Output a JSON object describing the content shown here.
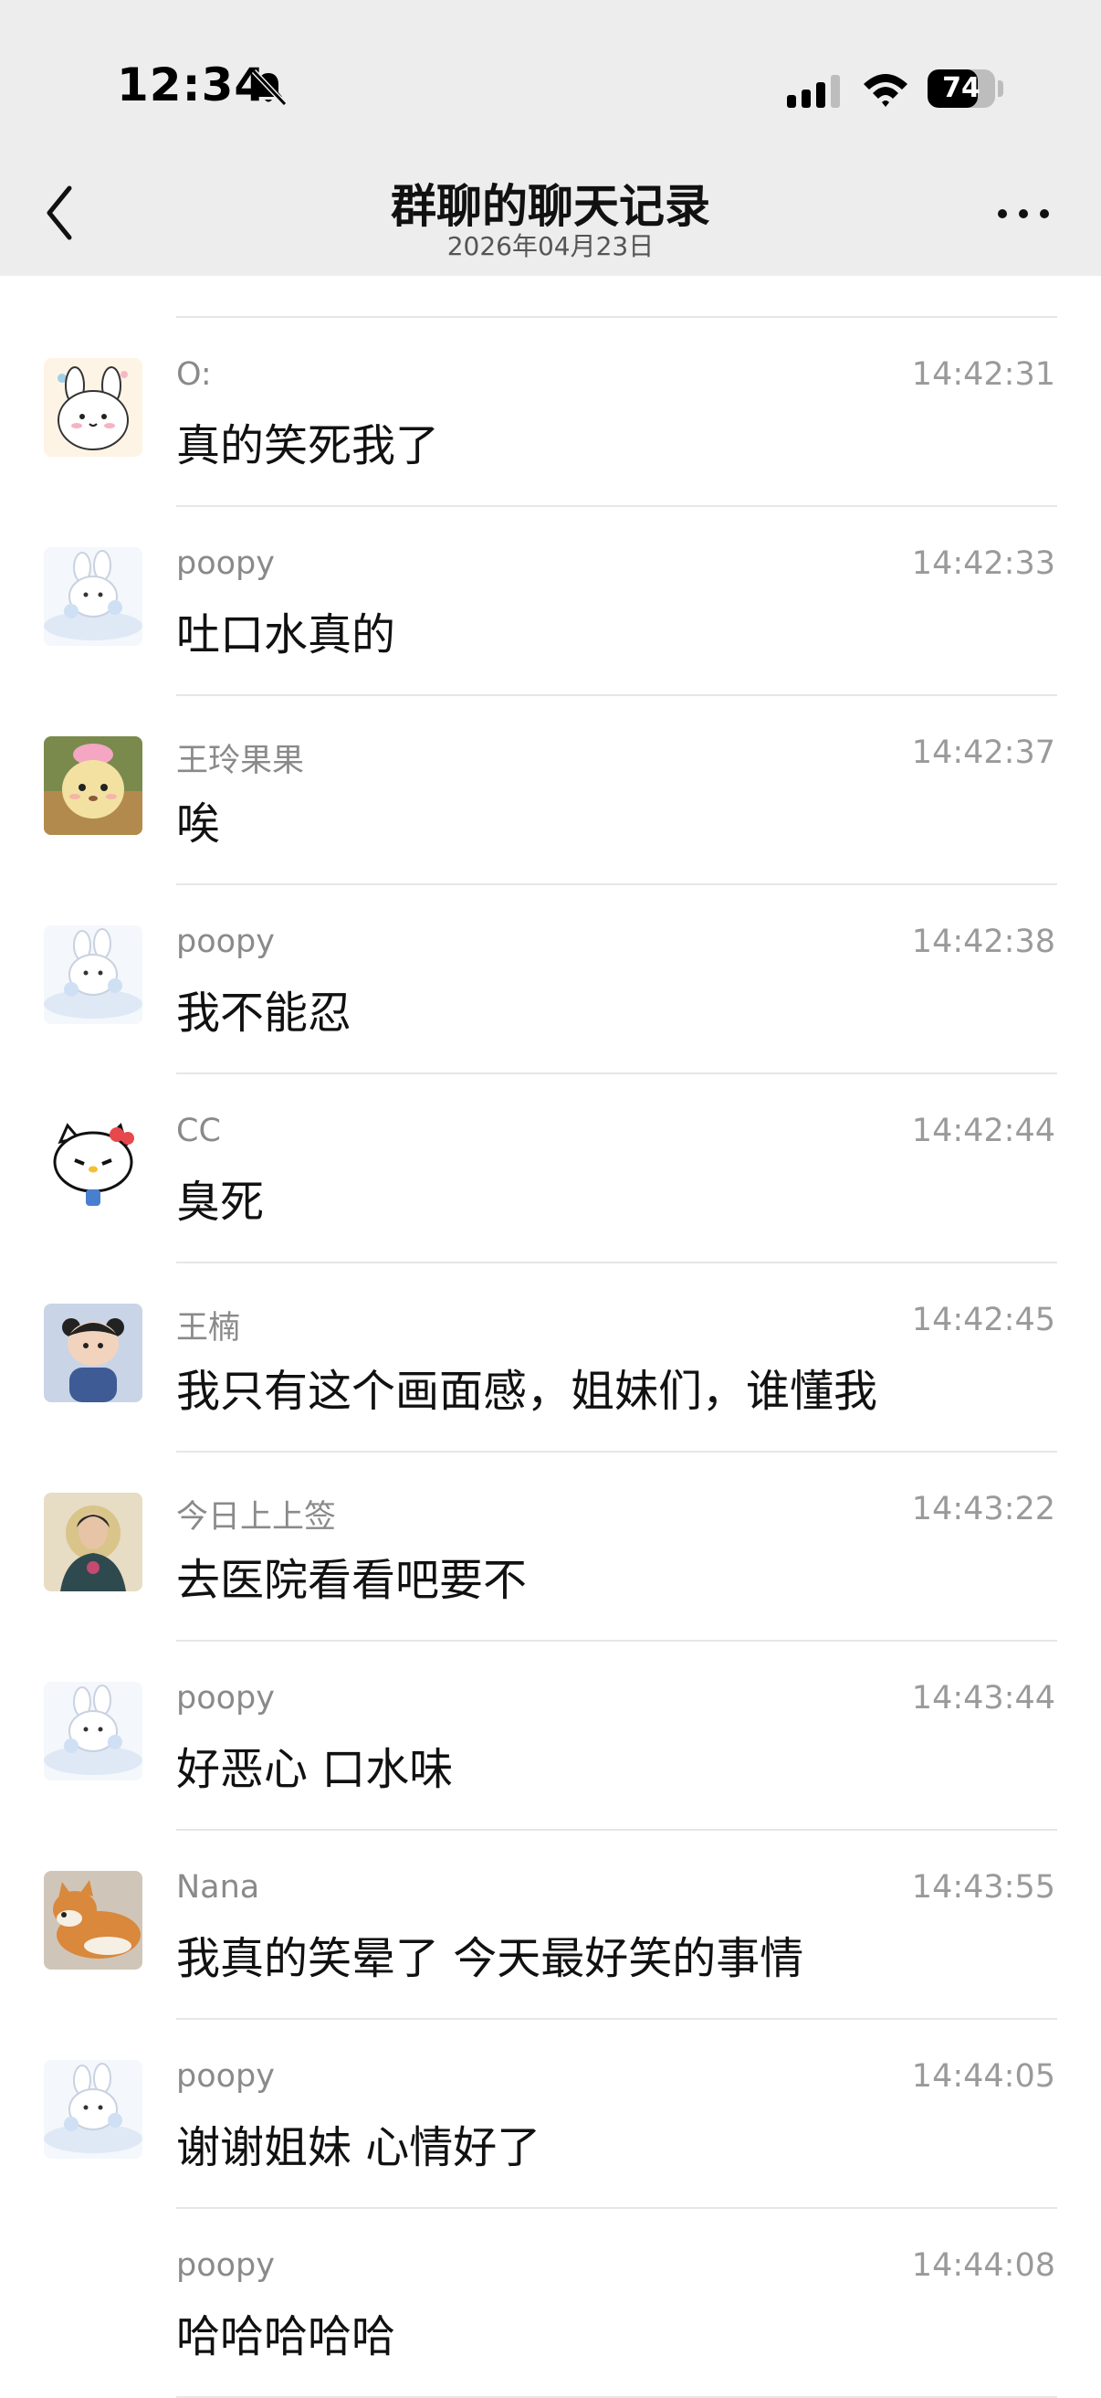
{
  "status_bar": {
    "time": "12:34",
    "battery_level": "74",
    "battery_fraction": 0.74
  },
  "nav": {
    "title": "群聊的聊天记录",
    "subtitle": "2026年04月23日"
  },
  "messages": [
    {
      "sender": "O:",
      "time": "14:42:31",
      "text": "真的笑死我了",
      "avatar": "cartoon-bunny",
      "avatar_color": "#fdf4e6"
    },
    {
      "sender": "poopy",
      "time": "14:42:33",
      "text": "吐口水真的",
      "avatar": "white-bunny-cloud",
      "avatar_color": "#f4f7fb"
    },
    {
      "sender": "王玲果果",
      "time": "14:42:37",
      "text": "唉",
      "avatar": "plush-toy",
      "avatar_color": "#c9b86a"
    },
    {
      "sender": "poopy",
      "time": "14:42:38",
      "text": "我不能忍",
      "avatar": "white-bunny-cloud",
      "avatar_color": "#f4f7fb"
    },
    {
      "sender": "CC",
      "time": "14:42:44",
      "text": "臭死",
      "avatar": "hello-kitty",
      "avatar_color": "#ffffff"
    },
    {
      "sender": "王楠",
      "time": "14:42:45",
      "text": "我只有这个画面感，姐妹们，谁懂我",
      "avatar": "baby-photo",
      "avatar_color": "#c9d4e6"
    },
    {
      "sender": "今日上上签",
      "time": "14:43:22",
      "text": "去医院看看吧要不",
      "avatar": "portrait-painting",
      "avatar_color": "#e7dcc4"
    },
    {
      "sender": "poopy",
      "time": "14:43:44",
      "text": "好恶心 口水味",
      "avatar": "white-bunny-cloud",
      "avatar_color": "#f4f7fb"
    },
    {
      "sender": "Nana",
      "time": "14:43:55",
      "text": "我真的笑晕了 今天最好笑的事情",
      "avatar": "shiba-dog",
      "avatar_color": "#d9a873"
    },
    {
      "sender": "poopy",
      "time": "14:44:05",
      "text": "谢谢姐妹 心情好了",
      "avatar": "white-bunny-cloud",
      "avatar_color": "#f4f7fb"
    },
    {
      "sender": "poopy",
      "time": "14:44:08",
      "text": "哈哈哈哈哈",
      "avatar": "",
      "avatar_color": ""
    }
  ]
}
